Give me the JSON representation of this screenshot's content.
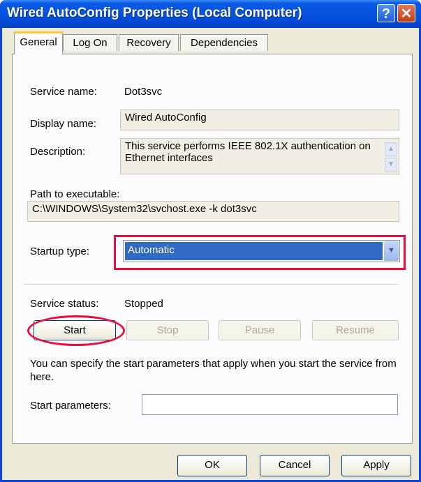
{
  "window": {
    "title": "Wired AutoConfig Properties (Local Computer)",
    "help_glyph": "?",
    "close_glyph": "✕"
  },
  "tabs": [
    {
      "label": "General",
      "active": true
    },
    {
      "label": "Log On",
      "active": false
    },
    {
      "label": "Recovery",
      "active": false
    },
    {
      "label": "Dependencies",
      "active": false
    }
  ],
  "general": {
    "service_name_label": "Service name:",
    "service_name_value": "Dot3svc",
    "display_name_label": "Display name:",
    "display_name_value": "Wired AutoConfig",
    "description_label": "Description:",
    "description_value": "This service performs IEEE 802.1X authentication on Ethernet interfaces",
    "path_label": "Path to executable:",
    "path_value": "C:\\WINDOWS\\System32\\svchost.exe -k dot3svc",
    "startup_type_label": "Startup type:",
    "startup_type_value": "Automatic",
    "service_status_label": "Service status:",
    "service_status_value": "Stopped",
    "buttons": {
      "start": "Start",
      "stop": "Stop",
      "pause": "Pause",
      "resume": "Resume"
    },
    "info_text": "You can specify the start parameters that apply when you start the service from here.",
    "start_parameters_label": "Start parameters:",
    "start_parameters_value": ""
  },
  "footer": {
    "ok": "OK",
    "cancel": "Cancel",
    "apply": "Apply"
  },
  "icons": {
    "scroll_up": "up-arrow-icon",
    "scroll_down": "down-arrow-icon",
    "dropdown": "chevron-down-icon"
  },
  "colors": {
    "titlebar": "#0553e0",
    "highlight": "#316ac5",
    "annotation": "#e8103a"
  }
}
